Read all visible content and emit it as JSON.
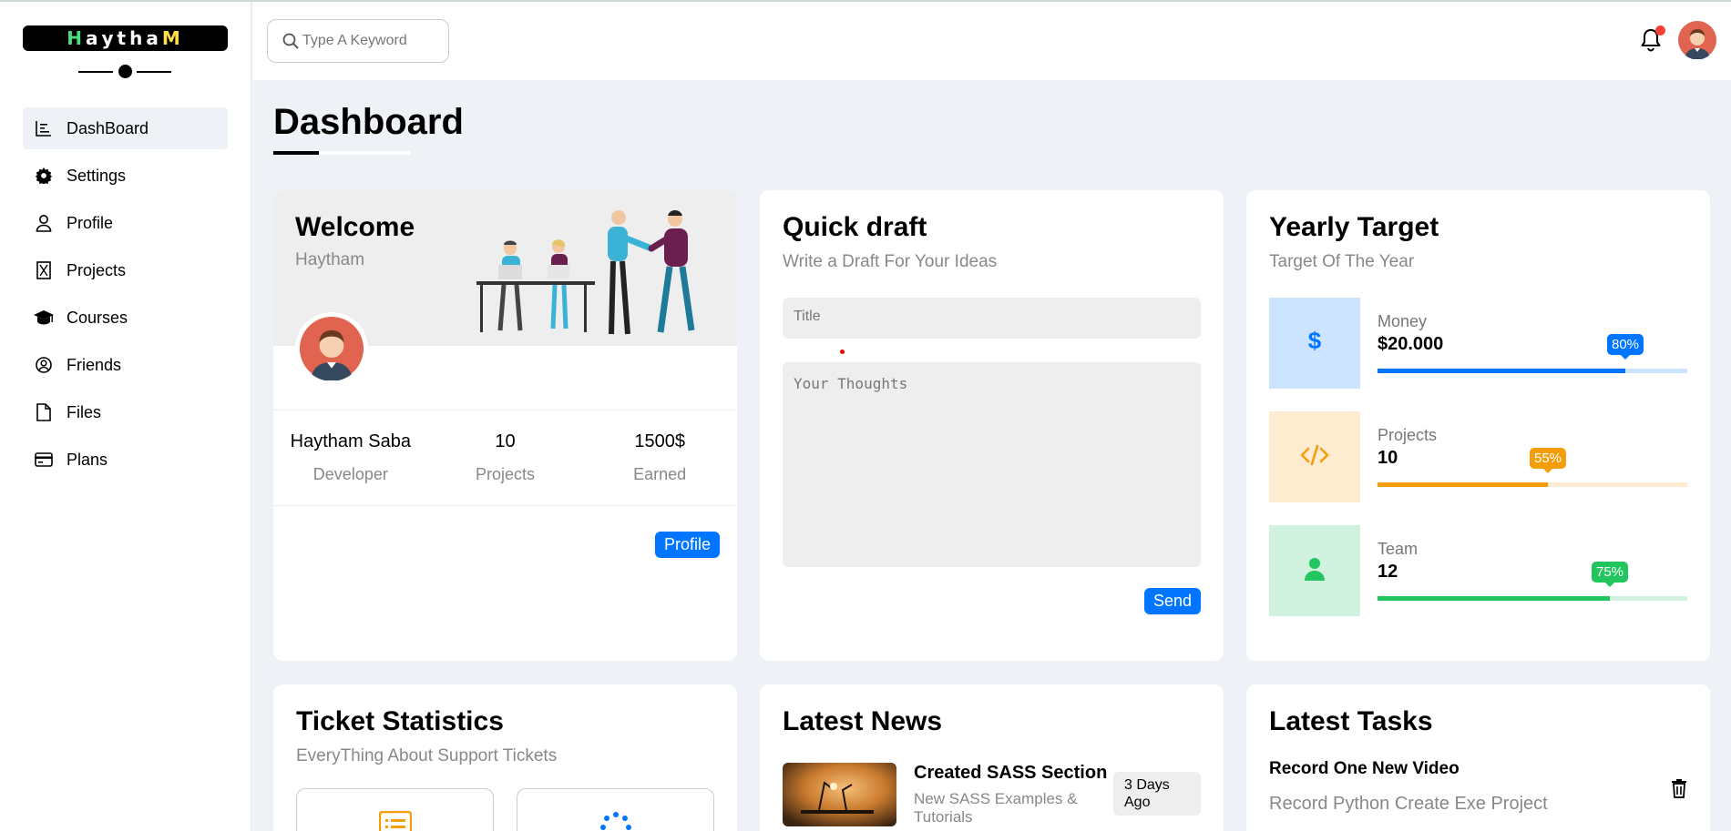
{
  "app": {
    "logo_letters": [
      {
        "char": "H",
        "color": "#4ade80"
      },
      {
        "char": "a",
        "color": "#ffffff"
      },
      {
        "char": "y",
        "color": "#ffffff"
      },
      {
        "char": "t",
        "color": "#ffffff"
      },
      {
        "char": "h",
        "color": "#ffffff"
      },
      {
        "char": "a",
        "color": "#ffffff"
      },
      {
        "char": "M",
        "color": "#fde047"
      }
    ]
  },
  "sidebar": {
    "items": [
      {
        "label": "DashBoard",
        "icon": "chart-bars-icon",
        "active": true
      },
      {
        "label": "Settings",
        "icon": "gear-icon"
      },
      {
        "label": "Profile",
        "icon": "user-icon"
      },
      {
        "label": "Projects",
        "icon": "hourglass-icon"
      },
      {
        "label": "Courses",
        "icon": "graduation-cap-icon"
      },
      {
        "label": "Friends",
        "icon": "user-circle-icon"
      },
      {
        "label": "Files",
        "icon": "file-icon"
      },
      {
        "label": "Plans",
        "icon": "credit-card-icon"
      }
    ]
  },
  "header": {
    "search_placeholder": "Type A Keyword",
    "notification_color": "#f44336"
  },
  "page": {
    "title": "Dashboard"
  },
  "welcome": {
    "title": "Welcome",
    "name_sub": "Haytham",
    "stats": [
      {
        "value": "Haytham Saba",
        "label": "Developer"
      },
      {
        "value": "10",
        "label": "Projects"
      },
      {
        "value": "1500$",
        "label": "Earned"
      }
    ],
    "profile_button": "Profile"
  },
  "draft": {
    "title": "Quick draft",
    "subtitle": "Write a Draft For Your Ideas",
    "title_placeholder": "Title",
    "body_placeholder": "Your Thoughts",
    "send_button": "Send"
  },
  "target": {
    "title": "Yearly Target",
    "subtitle": "Target Of The Year",
    "rows": [
      {
        "label": "Money",
        "value": "$20.000",
        "percent": 80,
        "percent_label": "80%",
        "color": "#0075ff",
        "track": "#cce4ff",
        "box_bg": "#cce4ff",
        "icon": "dollar-icon"
      },
      {
        "label": "Projects",
        "value": "10",
        "percent": 55,
        "percent_label": "55%",
        "color": "#f59e0b",
        "track": "#fdecd0",
        "box_bg": "#fdecd0",
        "icon": "code-icon"
      },
      {
        "label": "Team",
        "value": "12",
        "percent": 75,
        "percent_label": "75%",
        "color": "#22c55e",
        "track": "#d1f2df",
        "box_bg": "#d1f2df",
        "icon": "user-icon"
      }
    ]
  },
  "tickets": {
    "title": "Ticket Statistics",
    "subtitle": "EveryThing About Support Tickets"
  },
  "news": {
    "title": "Latest News",
    "items": [
      {
        "title": "Created SASS Section",
        "desc": "New SASS Examples & Tutorials",
        "ago": "3 Days Ago"
      }
    ]
  },
  "tasks": {
    "title": "Latest Tasks",
    "items": [
      {
        "title": "Record One New Video",
        "desc": "Record Python Create Exe Project"
      }
    ]
  }
}
